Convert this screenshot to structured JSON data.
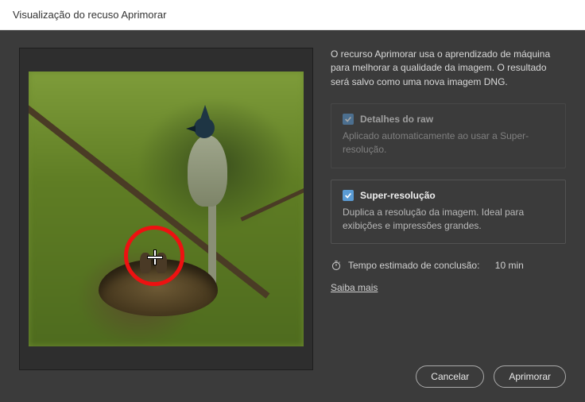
{
  "window": {
    "title": "Visualização do recuso Aprimorar"
  },
  "intro": "O recurso Aprimorar usa o aprendizado de máquina para melhorar a qualidade da imagem. O resultado será salvo como uma nova imagem DNG.",
  "option_raw": {
    "title": "Detalhes do raw",
    "desc": "Aplicado automaticamente ao usar a Super-resolução.",
    "checked": true,
    "enabled": false
  },
  "option_super": {
    "title": "Super-resolução",
    "desc": "Duplica a resolução da imagem. Ideal para exibições e impressões grandes.",
    "checked": true,
    "enabled": true
  },
  "estimate": {
    "label": "Tempo estimado de conclusão:",
    "value": "10 min"
  },
  "link": {
    "label": "Saiba mais"
  },
  "buttons": {
    "cancel": "Cancelar",
    "enhance": "Aprimorar"
  }
}
